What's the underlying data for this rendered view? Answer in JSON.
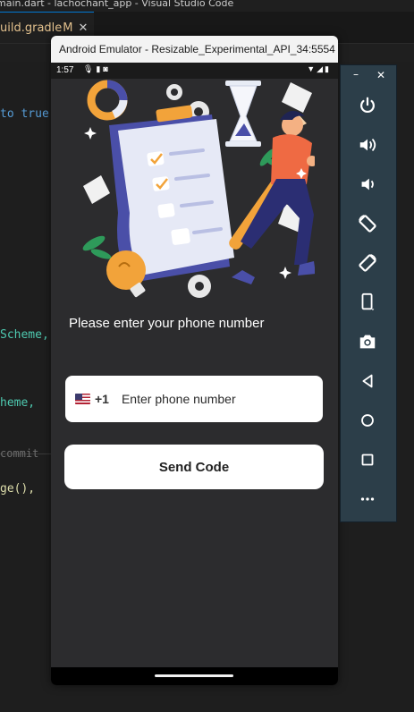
{
  "vscode": {
    "title": "main.dart - lachochant_app - Visual Studio Code",
    "tab_label": "uild.gradle",
    "tab_status": "M",
    "code_fragments": [
      {
        "text": "to true",
        "color": "blue"
      },
      {
        "text": "Scheme,",
        "color": "teal"
      },
      {
        "text": "heme,",
        "color": "teal"
      },
      {
        "text": "commit",
        "color": "dim"
      },
      {
        "text": "ge(),",
        "color": "fn"
      }
    ]
  },
  "emulator": {
    "title": "Android Emulator - Resizable_Experimental_API_34:5554"
  },
  "status_bar": {
    "time": "1:57"
  },
  "app": {
    "prompt": "Please enter your phone number",
    "country_flag": "us-flag",
    "country_code": "+1",
    "phone_placeholder": "Enter phone number",
    "phone_value": "",
    "send_label": "Send Code"
  },
  "toolbar": {
    "window_controls": [
      "minimize",
      "close"
    ],
    "buttons": [
      "power-icon",
      "volume-up-icon",
      "volume-down-icon",
      "rotate-left-icon",
      "rotate-right-icon",
      "fold-icon",
      "camera-icon",
      "back-icon",
      "home-icon",
      "overview-icon",
      "more-icon"
    ]
  },
  "colors": {
    "app_background": "#2c2c2e",
    "toolbar_background": "#2c3e49",
    "accent_orange": "#f2a33a",
    "illustration_blue": "#4a4fa8"
  }
}
